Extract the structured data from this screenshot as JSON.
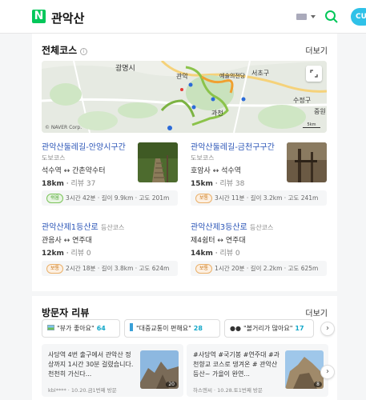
{
  "header": {
    "query": "관악산",
    "logo": "N",
    "user": "CU"
  },
  "courses_section": {
    "title": "전체코스",
    "more": "더보기",
    "map": {
      "labels": {
        "gwangmyeong": "광명시",
        "gwanak": "관악",
        "yesul": "예술의전당",
        "seocho": "서초구",
        "gwacheon": "과천",
        "suwon_gu": "수정구",
        "jung": "중원",
        "corp": "© NAVER Corp.",
        "scale": "5km"
      }
    },
    "courses": [
      {
        "name": "관악산둘레길-안양시구간",
        "type": "도보코스",
        "route": "석수역 ↔ 간촌약수터",
        "dist": "18km",
        "review": "리뷰 37",
        "level": "쉬움",
        "time": "3시간 42분",
        "len": "길이 9.9km",
        "alt": "고도 201m"
      },
      {
        "name": "관악산둘레길-금천구구간",
        "type": "도보코스",
        "route": "호암사 ↔ 석수역",
        "dist": "15km",
        "review": "리뷰 38",
        "level": "보통",
        "time": "3시간 11분",
        "len": "길이 3.2km",
        "alt": "고도 241m"
      },
      {
        "name": "관악산제1등산로",
        "type": "등산코스",
        "route": "관음사 ↔ 연주대",
        "dist": "12km",
        "review": "리뷰 0",
        "level": "보통",
        "time": "2시간 18분",
        "len": "길이 3.8km",
        "alt": "고도 624m"
      },
      {
        "name": "관악산제3등산로",
        "type": "등산코스",
        "route": "제4쉼터 ↔ 연주대",
        "dist": "14km",
        "review": "리뷰 0",
        "level": "보통",
        "time": "1시간 20분",
        "len": "길이 2.2km",
        "alt": "고도 625m"
      }
    ]
  },
  "review_section": {
    "title": "방문자 리뷰",
    "more": "더보기",
    "keywords": [
      {
        "icon": "landscape-icon",
        "text": "\"뷰가 좋아요\"",
        "count": "64"
      },
      {
        "icon": "bus-stop-icon",
        "text": "\"대중교통이 편해요\"",
        "count": "28"
      },
      {
        "icon": "eyes-icon",
        "text": "\"볼거리가 많아요\"",
        "count": "17"
      }
    ],
    "reviews": [
      {
        "text": "사당역 4번 출구에서 관악산 정상까지 1시간 30분 걸렸습니다. 천천히 가신다...",
        "meta": "kbl**** · 10.20.금1번째 방문",
        "photos": "20"
      },
      {
        "text": "#사당역 #국기봉 #연주대 #과천향교 코스로 댕겨온 # 관악산 등산~ 가을이 완연...",
        "meta": "하스엔씨 · 10.28.토1번째 방문",
        "photos": "8"
      }
    ]
  },
  "colors": {
    "brand": "#03c75a",
    "link": "#2b55b7",
    "easy": "#3a9a1f",
    "normal": "#c87312",
    "accent": "#14a8c9"
  }
}
